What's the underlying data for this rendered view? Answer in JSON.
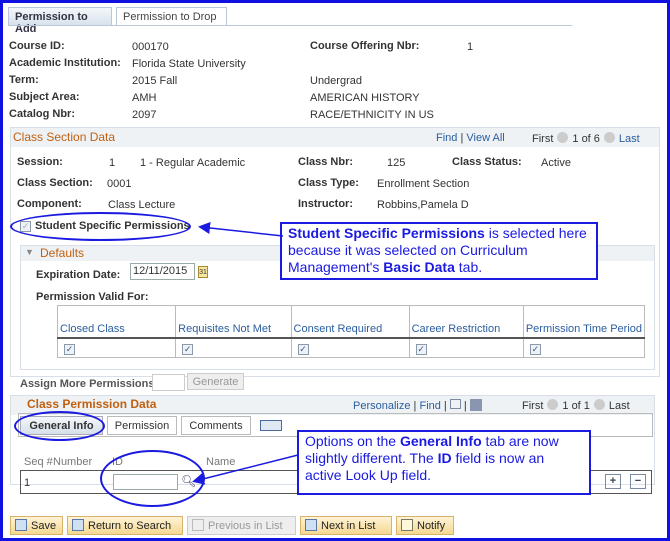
{
  "tabs": [
    "Permission to Add",
    "Permission to Drop"
  ],
  "course": {
    "course_id_label": "Course ID:",
    "course_id": "000170",
    "offering_label": "Course Offering Nbr:",
    "offering": "1",
    "institution_label": "Academic Institution:",
    "institution": "Florida State University",
    "term_label": "Term:",
    "term": "2015 Fall",
    "career": "Undergrad",
    "subject_label": "Subject Area:",
    "subject": "AMH",
    "subject_desc": "AMERICAN HISTORY",
    "catalog_label": "Catalog Nbr:",
    "catalog": "2097",
    "catalog_desc": "RACE/ETHNICITY IN US"
  },
  "section": {
    "title": "Class Section Data",
    "find": "Find",
    "view_all": "View All",
    "first": "First",
    "count": "1 of 6",
    "last": "Last",
    "session_label": "Session:",
    "session": "1",
    "session_desc": "1 - Regular Academic",
    "class_nbr_label": "Class Nbr:",
    "class_nbr": "125",
    "status_label": "Class Status:",
    "status": "Active",
    "section_label": "Class Section:",
    "section": "0001",
    "type_label": "Class Type:",
    "type": "Enrollment Section",
    "component_label": "Component:",
    "component": "Class Lecture",
    "instructor_label": "Instructor:",
    "instructor": "Robbins,Pamela D",
    "ssp_label": "Student Specific Permissions",
    "ssp_checked": true
  },
  "defaults": {
    "title": "Defaults",
    "exp_label": "Expiration Date:",
    "exp_value": "12/11/2015",
    "valid_label": "Permission Valid For:",
    "columns": [
      "Closed Class",
      "Requisites Not Met",
      "Consent Required",
      "Career Restriction",
      "Permission Time Period"
    ],
    "checked": [
      true,
      true,
      true,
      true,
      true
    ]
  },
  "assign": {
    "label": "Assign More Permissions:",
    "value": "",
    "generate": "Generate"
  },
  "perm": {
    "title": "Class Permission Data",
    "personalize": "Personalize",
    "find": "Find",
    "first": "First",
    "count": "1 of 1",
    "last": "Last",
    "tabs": [
      "General Info",
      "Permission",
      "Comments"
    ],
    "columns": [
      "Seq #",
      "Number",
      "ID",
      "Name"
    ],
    "row": {
      "seq": "1",
      "number": "",
      "id": ""
    }
  },
  "callouts": {
    "c1": {
      "b1": "Student Specific Permissions",
      "t1": " is selected here because it was selected on Curriculum Management's ",
      "b2": "Basic Data",
      "t2": " tab."
    },
    "c2": {
      "t1": "Options on the ",
      "b1": "General Info",
      "t2": " tab are now slightly different. The ",
      "b2": "ID",
      "t3": " field is now an active Look Up field."
    }
  },
  "buttons": [
    "Save",
    "Return to Search",
    "Previous in List",
    "Next in List",
    "Notify"
  ],
  "colors": {
    "annotation": "#1a1ae0",
    "section_title": "#c06010",
    "link": "#2a5ea0"
  }
}
